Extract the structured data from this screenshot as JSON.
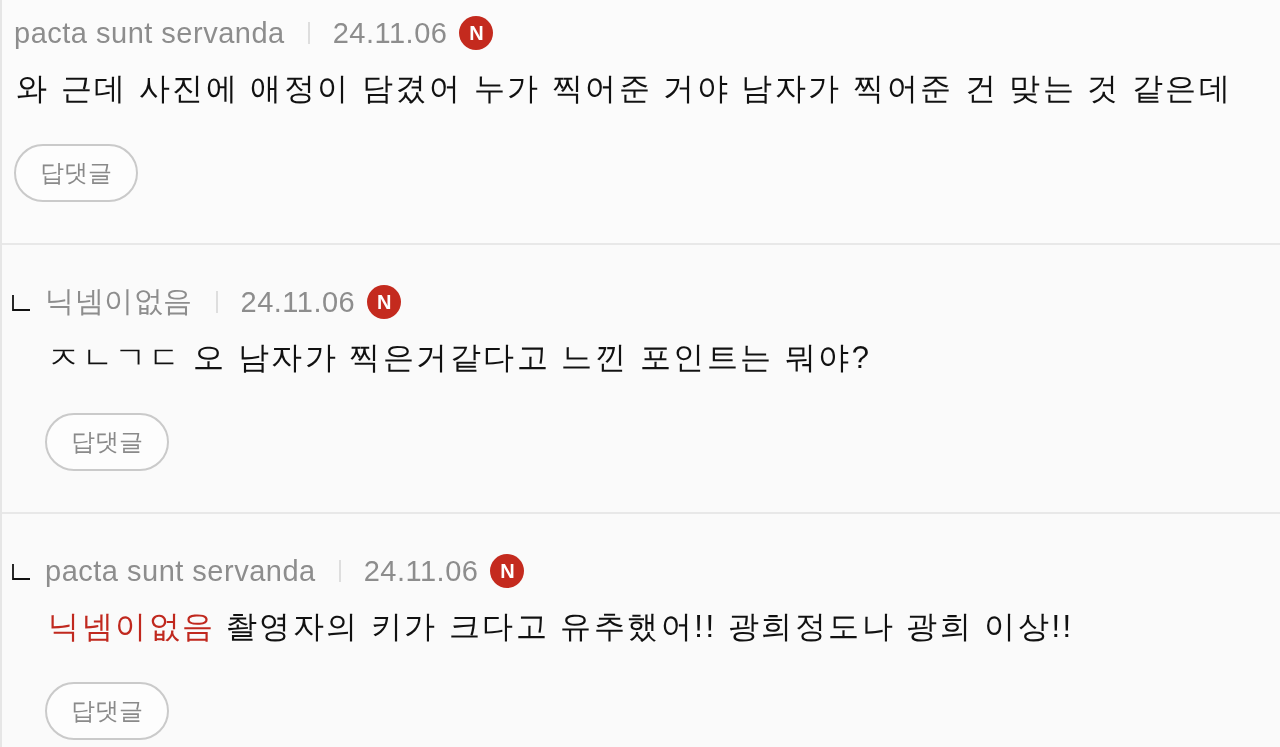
{
  "comments": [
    {
      "reply": false,
      "author": "pacta sunt servanda",
      "date": "24.11.06",
      "badge": "N",
      "text": "와 근데 사진에 애정이 담겼어 누가 찍어준 거야 남자가 찍어준 건 맞는 것 같은데",
      "reply_button": "답댓글"
    },
    {
      "reply": true,
      "author": "닉넴이없음",
      "date": "24.11.06",
      "badge": "N",
      "text": "ㅈㄴㄱㄷ 오 남자가 찍은거같다고 느낀 포인트는 뭐야?",
      "reply_button": "답댓글"
    },
    {
      "reply": true,
      "author": "pacta sunt servanda",
      "date": "24.11.06",
      "badge": "N",
      "mention": "닉넴이없음",
      "text": "촬영자의 키가 크다고 유추했어!! 광희정도나 광희 이상!!",
      "reply_button": "답댓글"
    }
  ]
}
